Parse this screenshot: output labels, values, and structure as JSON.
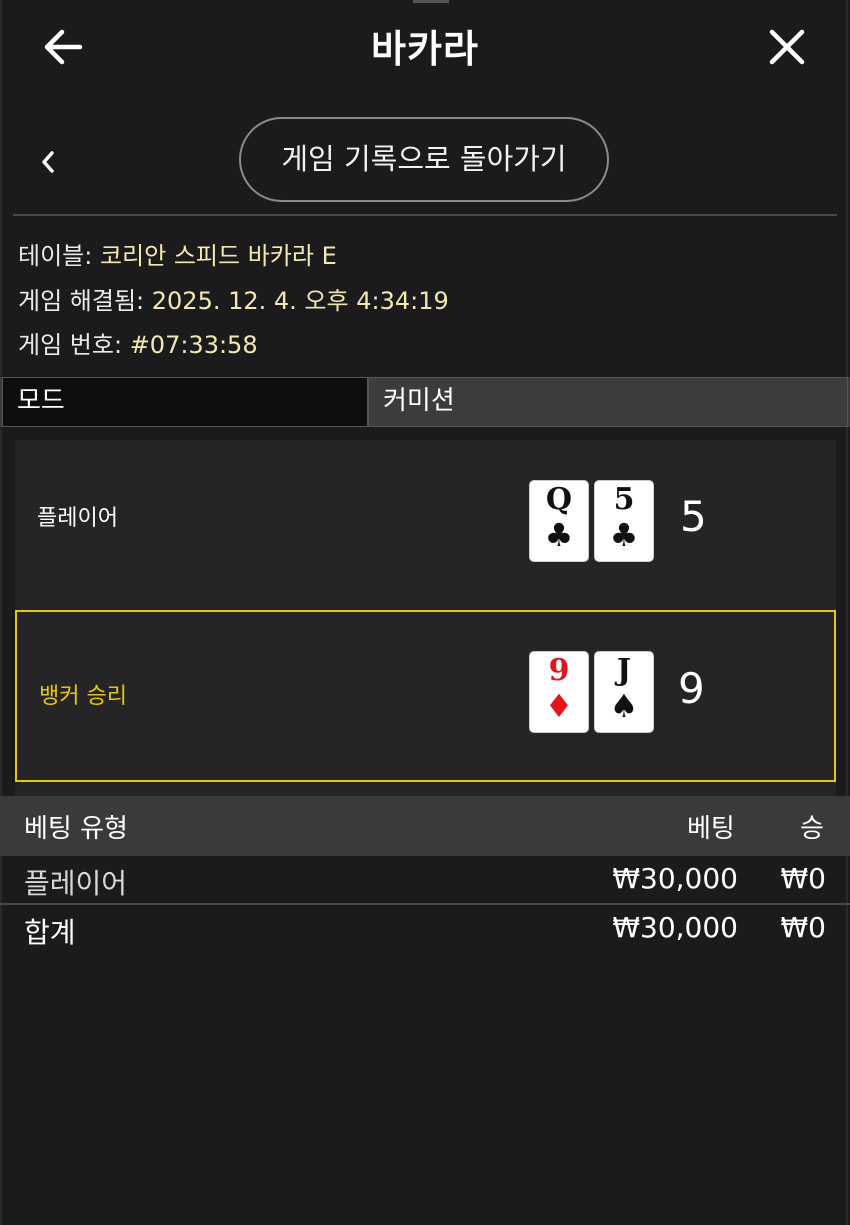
{
  "header": {
    "title": "바카라",
    "back_icon": "arrow-left-icon",
    "close_icon": "close-icon"
  },
  "subnav": {
    "chevron_icon": "chevron-left-icon",
    "back_to_history_label": "게임 기록으로 돌아가기"
  },
  "info": {
    "table_label": "테이블:",
    "table_value": "코리안 스피드 바카라 E",
    "resolved_label": "게임 해결됨:",
    "resolved_value": "2025. 12. 4. 오후 4:34:19",
    "game_no_label": "게임 번호:",
    "game_no_value": "#07:33:58"
  },
  "tabs": {
    "mode": "모드",
    "commission": "커미션"
  },
  "outcome": {
    "player": {
      "label": "플레이어",
      "cards": [
        {
          "rank": "Q",
          "suit": "♣",
          "color": "black"
        },
        {
          "rank": "5",
          "suit": "♣",
          "color": "black"
        }
      ],
      "score": "5"
    },
    "banker": {
      "label": "뱅커 승리",
      "cards": [
        {
          "rank": "9",
          "suit": "♦",
          "color": "red"
        },
        {
          "rank": "J",
          "suit": "♠",
          "color": "black"
        }
      ],
      "score": "9"
    },
    "winner_color": "#e6c514"
  },
  "bets": {
    "headers": {
      "type": "베팅 유형",
      "bet": "베팅",
      "win": "승"
    },
    "rows": [
      {
        "type": "플레이어",
        "bet": "₩30,000",
        "win": "₩0"
      }
    ],
    "total": {
      "type": "합계",
      "bet": "₩30,000",
      "win": "₩0"
    }
  }
}
